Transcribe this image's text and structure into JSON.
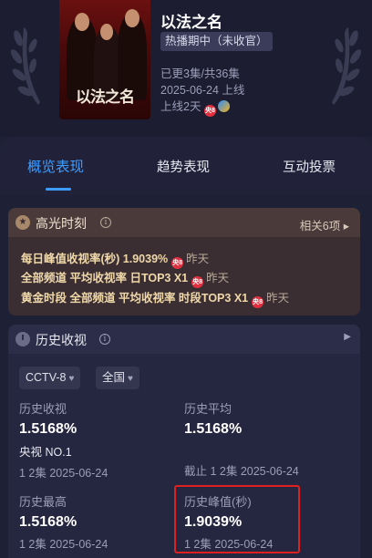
{
  "show": {
    "title": "以法之名",
    "poster_title": "以法之名",
    "status_badge": "热播期中（未收官）",
    "episodes": "已更3集/共36集",
    "premiere": "2025-06-24 上线",
    "days_online": "上线2天",
    "channel_logo_text": "央8"
  },
  "tabs": [
    {
      "label": "概览表现",
      "active": true
    },
    {
      "label": "趋势表现",
      "active": false
    },
    {
      "label": "互动投票",
      "active": false
    }
  ],
  "highlights": {
    "title": "高光时刻",
    "info": "i",
    "related": "相关6项 ▸",
    "rows": [
      {
        "text": "每日峰值收视率(秒)  1.9039%",
        "when": "昨天"
      },
      {
        "text": "全部频道 平均收视率 日TOP3 X1",
        "when": "昨天"
      },
      {
        "text": "黄金时段 全部频道 平均收视率 时段TOP3 X1",
        "when": "昨天"
      }
    ]
  },
  "history": {
    "title": "历史收视",
    "info": "i",
    "arrow": "▶",
    "filters": [
      {
        "label": "CCTV-8",
        "icon": "♥"
      },
      {
        "label": "全国",
        "icon": "♥"
      }
    ],
    "stats": [
      {
        "label": "历史收视",
        "value": "1.5168%",
        "sub": "央视 NO.1",
        "note": "1 2集 2025-06-24"
      },
      {
        "label": "历史平均",
        "value": "1.5168%",
        "sub": "",
        "note": "截止 1 2集 2025-06-24"
      },
      {
        "label": "历史最高",
        "value": "1.5168%",
        "sub": "",
        "note": "1 2集 2025-06-24"
      },
      {
        "label": "历史峰值(秒)",
        "value": "1.9039%",
        "sub": "",
        "note": "1 2集 2025-06-24"
      }
    ]
  },
  "colors": {
    "accent": "#3d9dff",
    "highlight_text": "#f0d8a8",
    "annotation_box": "#e02020"
  }
}
